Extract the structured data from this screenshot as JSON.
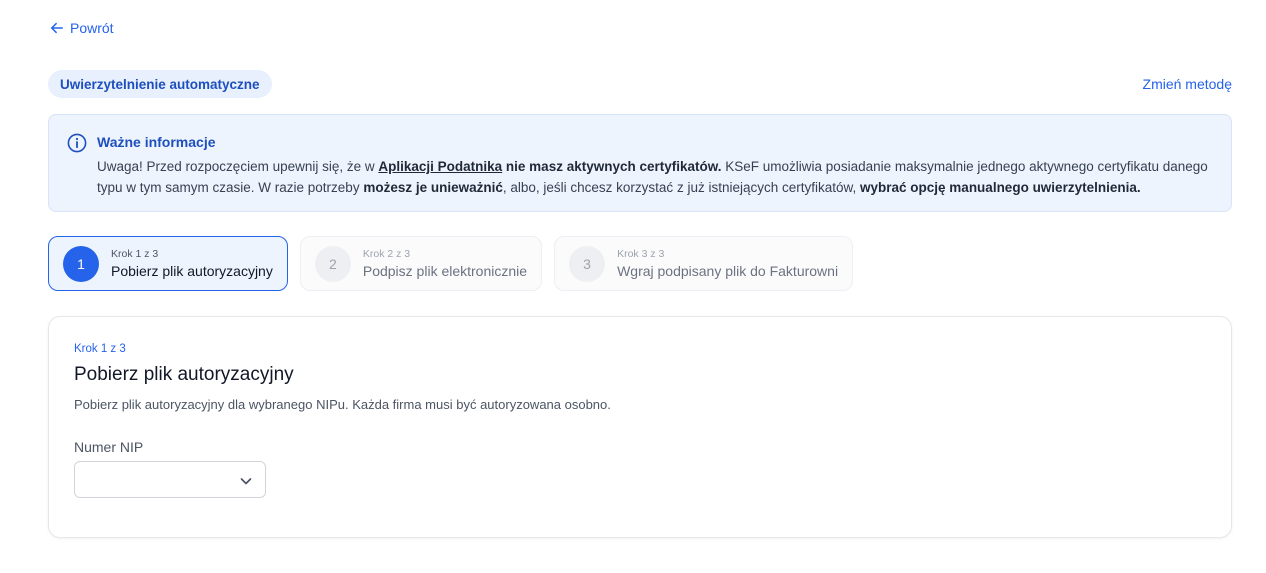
{
  "back": {
    "label": "Powrót"
  },
  "method": {
    "badge": "Uwierzytelnienie automatyczne",
    "change_label": "Zmień metodę"
  },
  "info": {
    "title": "Ważne informacje",
    "p1": "Uwaga! Przed rozpoczęciem upewnij się, że w ",
    "link": "Aplikacji Podatnika",
    "b1": " nie masz aktywnych certyfikatów.",
    "p2": " KSeF umożliwia posiadanie maksymalnie jednego aktywnego certyfikatu danego typu w tym samym czasie. W razie potrzeby ",
    "b2": "możesz je unieważnić",
    "p3": ", albo, jeśli chcesz korzystać z już istniejących certyfikatów, ",
    "b3": "wybrać opcję manualnego uwierzytelnienia."
  },
  "steps": [
    {
      "num": "1",
      "sub": "Krok 1 z 3",
      "title": "Pobierz plik autoryzacyjny"
    },
    {
      "num": "2",
      "sub": "Krok 2 z 3",
      "title": "Podpisz plik elektronicznie"
    },
    {
      "num": "3",
      "sub": "Krok 3 z 3",
      "title": "Wgraj podpisany plik do Fakturowni"
    }
  ],
  "card": {
    "step_label": "Krok 1 z 3",
    "title": "Pobierz plik autoryzacyjny",
    "description": "Pobierz plik autoryzacyjny dla wybranego NIPu. Każda firma musi być autoryzowana osobno.",
    "nip_label": "Numer NIP",
    "nip_value": ""
  },
  "colors": {
    "accent": "#2563eb",
    "info_bg": "#eef4fd"
  }
}
